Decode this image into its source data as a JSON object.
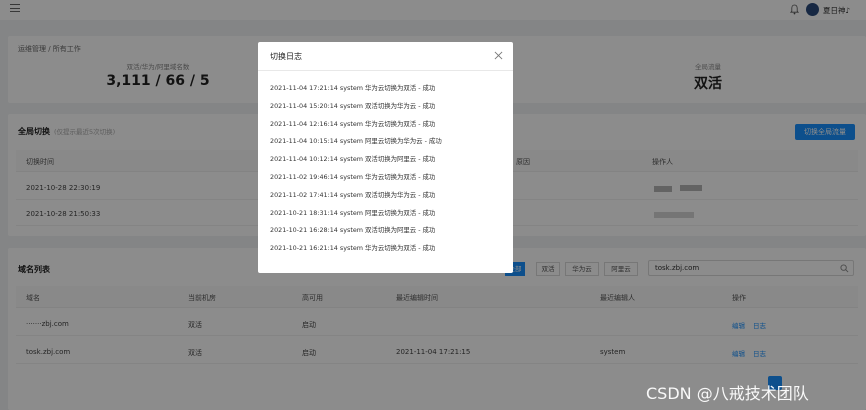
{
  "header": {
    "username": "夏日神♪"
  },
  "breadcrumb": "运维管理  /  所有工作",
  "stats": [
    {
      "label": "双活/华为/阿里域名数",
      "value": "3,111 / 66 / 5"
    },
    {
      "label": "全局流量",
      "value": "双活"
    }
  ],
  "global_switch": {
    "title": "全局切换",
    "subtitle": "(仅提示最近5次切换)",
    "button_label": "切换全局流量",
    "columns": [
      "切换时间",
      "原因",
      "操作人"
    ],
    "rows": [
      {
        "time": "2021-10-28 22:30:19"
      },
      {
        "time": "2021-10-28 21:50:33"
      }
    ]
  },
  "domain_list": {
    "title": "域名列表",
    "filters": [
      "全部",
      "双活",
      "华为云",
      "阿里云"
    ],
    "search_value": "tosk.zbj.com",
    "columns": [
      "域名",
      "当前机房",
      "高可用",
      "最近编辑时间",
      "最近编辑人",
      "操作"
    ],
    "rows": [
      {
        "domain": "·······zbj.com",
        "room": "双活",
        "ha": "启动",
        "time": "",
        "editor": "",
        "edit": "编辑",
        "log": "日志"
      },
      {
        "domain": "tosk.zbj.com",
        "room": "双活",
        "ha": "启动",
        "time": "2021-11-04 17:21:15",
        "editor": "system",
        "edit": "编辑",
        "log": "日志"
      }
    ]
  },
  "modal": {
    "title": "切换日志",
    "logs": [
      "2021-11-04 17:21:14 system 华为云切换为双活 - 成功",
      "2021-11-04 15:20:14 system 双活切换为华为云 - 成功",
      "2021-11-04 12:16:14 system 华为云切换为双活 - 成功",
      "2021-11-04 10:15:14 system 阿里云切换为华为云 - 成功",
      "2021-11-04 10:12:14 system 双活切换为阿里云 - 成功",
      "2021-11-02 19:46:14 system 华为云切换为双活 - 成功",
      "2021-11-02 17:41:14 system 双活切换为华为云 - 成功",
      "2021-10-21 18:31:14 system 阿里云切换为双活 - 成功",
      "2021-10-21 16:28:14 system 双活切换为阿里云 - 成功",
      "2021-10-21 16:21:14 system 华为云切换为双活 - 成功"
    ]
  },
  "watermark": "CSDN @八戒技术团队"
}
